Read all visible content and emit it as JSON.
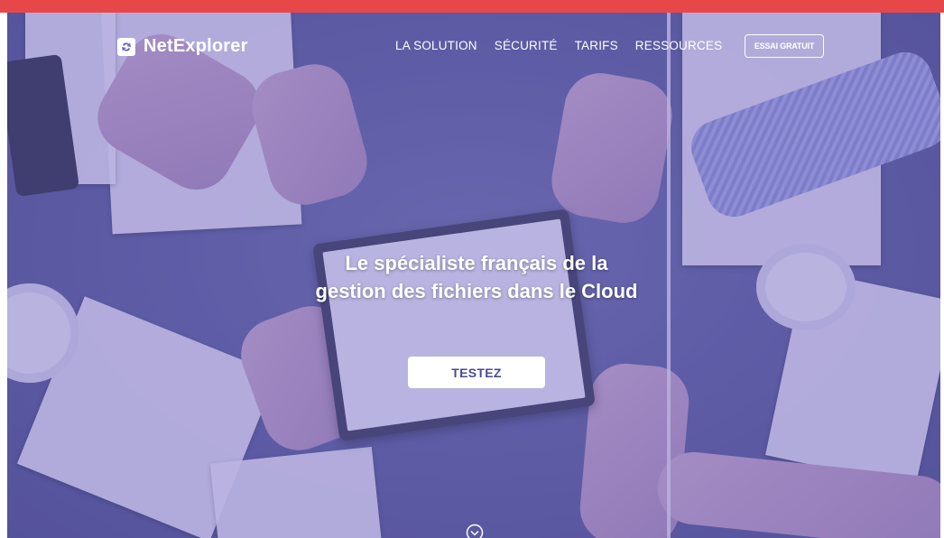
{
  "header": {
    "brand": "NetExplorer",
    "nav": [
      "LA SOLUTION",
      "SÉCURITÉ",
      "TARIFS",
      "RESSOURCES"
    ],
    "trial_label": "ESSAI GRATUIT"
  },
  "hero": {
    "title_line1": "Le spécialiste français de la",
    "title_line2": "gestion des fichiers dans le Cloud",
    "cta_label": "TESTEZ"
  },
  "colors": {
    "top_bar": "#e8474a",
    "overlay": "#6058be",
    "cta_text": "#4a4a95"
  },
  "icons": {
    "logo": "netexplorer-logo-icon",
    "scroll": "chevron-circle-down-icon"
  }
}
